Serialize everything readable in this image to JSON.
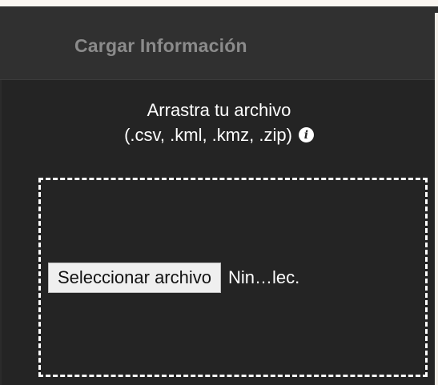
{
  "header": {
    "title": "Cargar Información"
  },
  "instructions": {
    "line_1": "Arrastra tu archivo",
    "line_2": "(.csv, .kml, .kmz, .zip)",
    "info_icon": "info-icon",
    "info_glyph": "i"
  },
  "upload": {
    "button_label": "Seleccionar archivo",
    "status_text": "Nin…lec."
  },
  "colors": {
    "panel_background": "#242424",
    "header_background": "#303030",
    "header_text": "#8b8b8b",
    "primary_text": "#ffffff",
    "dropzone_border": "#ffffff",
    "button_background": "#efefef"
  }
}
